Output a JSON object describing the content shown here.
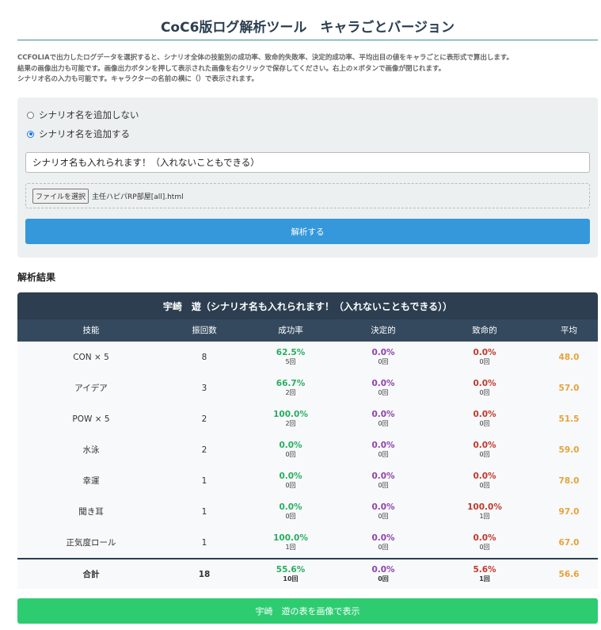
{
  "title": "CoC6版ログ解析ツール　キャラごとバージョン",
  "description": [
    "CCFOLIAで出力したログデータを選択すると、シナリオ全体の技能別の成功率、致命的失敗率、決定的成功率、平均出目の値をキャラごとに表形式で算出します。",
    "結果の画像出力も可能です。画像出力ボタンを押して表示された画像を右クリックで保存してください。右上の×ボタンで画像が閉じれます。",
    "シナリオ名の入力も可能です。キャラクターの名前の横に（）で表示されます。"
  ],
  "form": {
    "radio_no": "シナリオ名を追加しない",
    "radio_yes": "シナリオ名を追加する",
    "selected": "yes",
    "scenario_value": "シナリオ名も入れられます！（入れないこともできる）",
    "file_button": "ファイルを選択",
    "file_name": "主任ハピパRP部屋[all].html",
    "analyze_button": "解析する"
  },
  "results_title": "解析結果",
  "table": {
    "title": "宇崎　遊（シナリオ名も入れられます！（入れないこともできる））",
    "headers": [
      "技能",
      "振回数",
      "成功率",
      "決定的",
      "致命的",
      "平均"
    ],
    "rows": [
      [
        "CON × 5",
        "8",
        "62.5%",
        "5回",
        "0.0%",
        "0回",
        "0.0%",
        "0回",
        "48.0"
      ],
      [
        "アイデア",
        "3",
        "66.7%",
        "2回",
        "0.0%",
        "0回",
        "0.0%",
        "0回",
        "57.0"
      ],
      [
        "POW × 5",
        "2",
        "100.0%",
        "2回",
        "0.0%",
        "0回",
        "0.0%",
        "0回",
        "51.5"
      ],
      [
        "水泳",
        "2",
        "0.0%",
        "0回",
        "0.0%",
        "0回",
        "0.0%",
        "0回",
        "59.0"
      ],
      [
        "幸運",
        "1",
        "0.0%",
        "0回",
        "0.0%",
        "0回",
        "0.0%",
        "0回",
        "78.0"
      ],
      [
        "聞き耳",
        "1",
        "0.0%",
        "0回",
        "0.0%",
        "0回",
        "100.0%",
        "1回",
        "97.0"
      ],
      [
        "正気度ロール",
        "1",
        "100.0%",
        "1回",
        "0.0%",
        "0回",
        "0.0%",
        "0回",
        "67.0"
      ]
    ],
    "total": [
      "合計",
      "18",
      "55.6%",
      "10回",
      "0.0%",
      "0回",
      "5.6%",
      "1回",
      "56.6"
    ]
  },
  "image_button": "宇崎　遊の表を画像で表示"
}
